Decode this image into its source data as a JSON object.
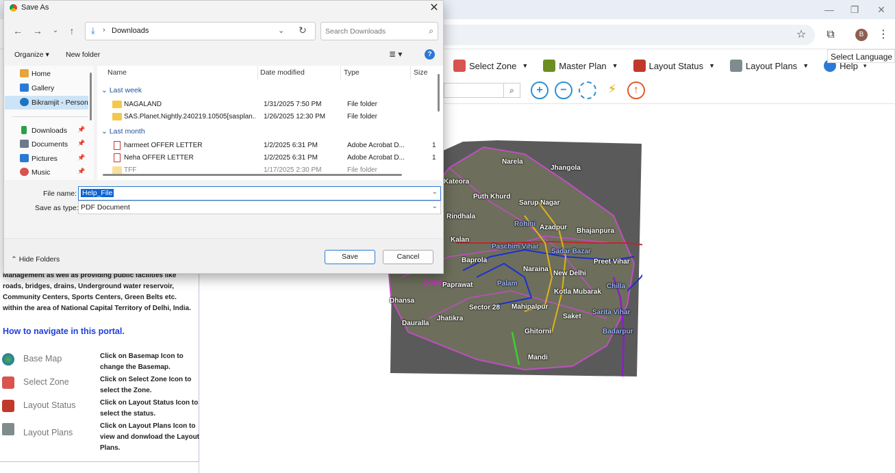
{
  "browser": {
    "window_controls": {
      "minimize": "—",
      "restore": "❐",
      "close": "✕"
    },
    "profile_initial": "B"
  },
  "portal": {
    "menu": [
      {
        "label": "Select Zone",
        "icon": "map-pin-icon",
        "color": "#d9534f"
      },
      {
        "label": "Master Plan",
        "icon": "board-icon",
        "color": "#6b8e23"
      },
      {
        "label": "Layout Status",
        "icon": "check-badge-icon",
        "color": "#c0392b"
      },
      {
        "label": "Layout Plans",
        "icon": "document-pen-icon",
        "color": "#7f8c8d"
      },
      {
        "label": "Help",
        "icon": "help-icon",
        "color": "#2b79d6"
      }
    ],
    "select_language": "Select Language",
    "info_text": "Management as well as providing public facilities like roads, bridges, drains, Underground water reservoir, Community Centers, Sports Centers, Green Belts etc. within the area of National Capital Territory of Delhi, India.",
    "nav_heading": "How to navigate in this portal.",
    "nav_items": [
      {
        "label": "Base Map",
        "desc": "Click on Basemap Icon to change the Basemap.",
        "icon": "globe-icon"
      },
      {
        "label": "Select Zone",
        "desc": "Click on Select Zone Icon to select the Zone.",
        "icon": "map-pin-icon"
      },
      {
        "label": "Layout Status",
        "desc": "Click on Layout Status Icon to select the status.",
        "icon": "check-badge-icon"
      },
      {
        "label": "Layout Plans",
        "desc": "Click on Layout Plans Icon to view and donwload the Layout Plans.",
        "icon": "document-pen-icon"
      }
    ]
  },
  "map": {
    "places": [
      "Narela",
      "Jhangola",
      "Kateora",
      "Puth Khurd",
      "Sarup Nagar",
      "Rohini",
      "Azadpur",
      "Bhajanpura",
      "Rindhala",
      "Kalan",
      "Paschim Vihar",
      "Sadar Bazar",
      "Preet Vihar",
      "Baprola",
      "Naraina",
      "New Delhi",
      "Zone",
      "Paprawat",
      "Palam",
      "Chilla",
      "Kotla Mubarak",
      "Dhansa",
      "Sector 28",
      "Mahipalpur",
      "Saket",
      "Sarita Vihar",
      "Dauralla",
      "Jhatikra",
      "Ghitorni",
      "Badarpur",
      "Mandi"
    ]
  },
  "dialog": {
    "title": "Save As",
    "address": {
      "path": "Downloads",
      "separator": "›"
    },
    "search_placeholder": "Search Downloads",
    "organize": "Organize ▾",
    "new_folder": "New folder",
    "view_toggle": "≣ ▾",
    "help": "?",
    "nav_pane": [
      {
        "label": "Home",
        "icon": "home-icon",
        "color": "#e8a33d",
        "pinned": false
      },
      {
        "label": "Gallery",
        "icon": "gallery-icon",
        "color": "#2b79d6",
        "pinned": false
      },
      {
        "label": "Bikramjit - Personal",
        "icon": "cloud-icon",
        "color": "#1e73be",
        "pinned": false,
        "selected": true
      },
      {
        "label": "Downloads",
        "icon": "download-icon",
        "color": "#2ea043",
        "pinned": true
      },
      {
        "label": "Documents",
        "icon": "documents-icon",
        "color": "#6c7a89",
        "pinned": true
      },
      {
        "label": "Pictures",
        "icon": "pictures-icon",
        "color": "#2b79d6",
        "pinned": true
      },
      {
        "label": "Music",
        "icon": "music-icon",
        "color": "#d9534f",
        "pinned": true
      }
    ],
    "columns": {
      "name": "Name",
      "date": "Date modified",
      "type": "Type",
      "size": "Size"
    },
    "groups": [
      {
        "label": "Last week",
        "files": [
          {
            "name": "NAGALAND",
            "date": "1/31/2025 7:50 PM",
            "type": "File folder",
            "size": "",
            "kind": "folder"
          },
          {
            "name": "SAS.Planet.Nightly.240219.10505[sasplan...",
            "date": "1/26/2025 12:30 PM",
            "type": "File folder",
            "size": "",
            "kind": "folder"
          }
        ]
      },
      {
        "label": "Last month",
        "files": [
          {
            "name": "harmeet OFFER LETTER",
            "date": "1/2/2025 6:31 PM",
            "type": "Adobe Acrobat D...",
            "size": "1",
            "kind": "pdf"
          },
          {
            "name": "Neha OFFER LETTER",
            "date": "1/2/2025 6:31 PM",
            "type": "Adobe Acrobat D...",
            "size": "1",
            "kind": "pdf"
          },
          {
            "name": "TFF",
            "date": "1/17/2025 2:30 PM",
            "type": "File folder",
            "size": "",
            "kind": "folder"
          }
        ]
      }
    ],
    "file_name_label": "File name:",
    "file_name_value": "Help_File",
    "save_type_label": "Save as type:",
    "save_type_value": "PDF Document",
    "hide_folders": "Hide Folders",
    "save": "Save",
    "cancel": "Cancel"
  }
}
